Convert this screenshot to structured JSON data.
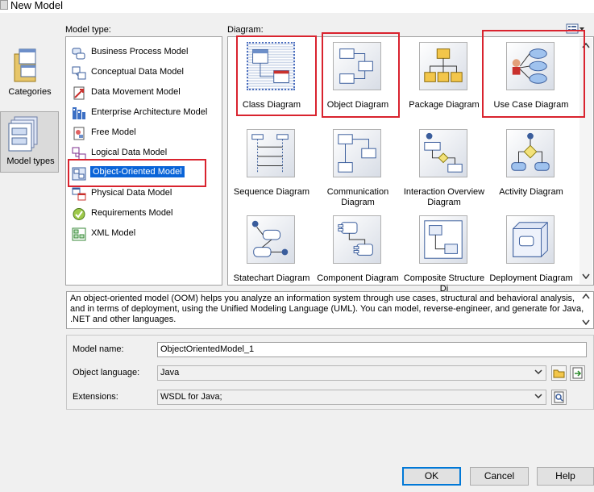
{
  "window": {
    "title": "New Model"
  },
  "categories": [
    {
      "label": "Categories",
      "selected": false
    },
    {
      "label": "Model types",
      "selected": true
    }
  ],
  "model_type": {
    "label": "Model type:",
    "items": [
      {
        "label": "Business Process Model",
        "icon": "business-process-icon"
      },
      {
        "label": "Conceptual Data Model",
        "icon": "conceptual-data-icon"
      },
      {
        "label": "Data Movement Model",
        "icon": "data-movement-icon"
      },
      {
        "label": "Enterprise Architecture Model",
        "icon": "enterprise-architecture-icon"
      },
      {
        "label": "Free Model",
        "icon": "free-model-icon"
      },
      {
        "label": "Logical Data Model",
        "icon": "logical-data-icon"
      },
      {
        "label": "Object-Oriented Model",
        "icon": "object-oriented-icon",
        "selected": true
      },
      {
        "label": "Physical Data Model",
        "icon": "physical-data-icon"
      },
      {
        "label": "Requirements Model",
        "icon": "requirements-icon"
      },
      {
        "label": "XML Model",
        "icon": "xml-model-icon"
      }
    ]
  },
  "diagram": {
    "label": "Diagram:",
    "items": [
      {
        "label": "Class Diagram",
        "selected": true
      },
      {
        "label": "Object Diagram"
      },
      {
        "label": "Package Diagram"
      },
      {
        "label": "Use Case Diagram"
      },
      {
        "label": "Sequence Diagram"
      },
      {
        "label": "Communication Diagram"
      },
      {
        "label": "Interaction Overview Diagram"
      },
      {
        "label": "Activity Diagram"
      },
      {
        "label": "Statechart Diagram"
      },
      {
        "label": "Component Diagram"
      },
      {
        "label": "Composite Structure Di"
      },
      {
        "label": "Deployment Diagram"
      }
    ]
  },
  "description": "An object-oriented model (OOM) helps you analyze an information system through use cases, structural and behavioral analysis, and in terms of deployment, using the Unified Modeling Language (UML). You can model, reverse-engineer, and generate for Java, .NET and other languages.",
  "form": {
    "model_name_label": "Model name:",
    "model_name_value": "ObjectOrientedModel_1",
    "object_language_label": "Object language:",
    "object_language_value": "Java",
    "extensions_label": "Extensions:",
    "extensions_value": "WSDL for Java;"
  },
  "buttons": {
    "ok": "OK",
    "cancel": "Cancel",
    "help": "Help"
  },
  "colors": {
    "highlight": "#0a64d8",
    "annotation": "#d9232e"
  }
}
